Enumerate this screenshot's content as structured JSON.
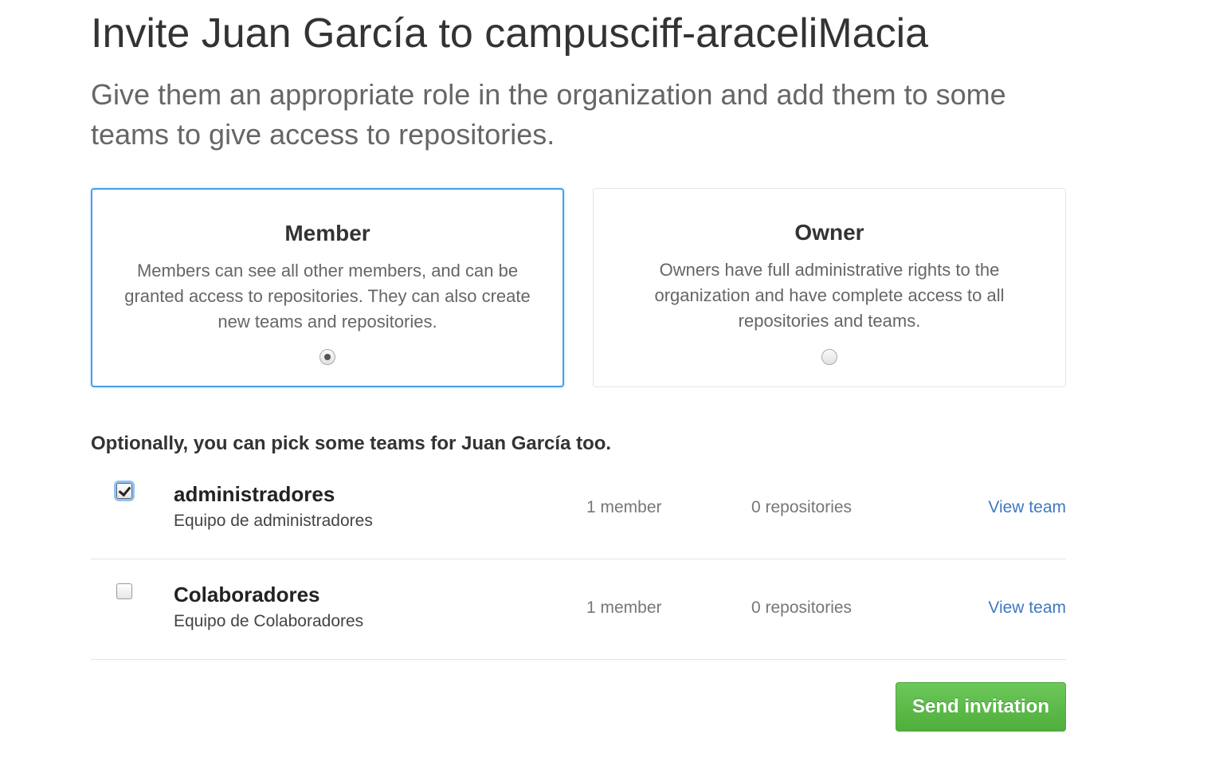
{
  "header": {
    "title": "Invite Juan García to campusciff-araceliMacia",
    "subtitle": "Give them an appropriate role in the organization and add them to some teams to give access to repositories."
  },
  "roles": [
    {
      "title": "Member",
      "description": "Members can see all other members, and can be granted access to repositories. They can also create new teams and repositories.",
      "selected": true
    },
    {
      "title": "Owner",
      "description": "Owners have full administrative rights to the organization and have complete access to all repositories and teams.",
      "selected": false
    }
  ],
  "teams": {
    "heading": "Optionally, you can pick some teams for Juan García too.",
    "items": [
      {
        "name": "administradores",
        "description": "Equipo de administradores",
        "members": "1 member",
        "repositories": "0 repositories",
        "link_label": "View team",
        "checked": true
      },
      {
        "name": "Colaboradores",
        "description": "Equipo de Colaboradores",
        "members": "1 member",
        "repositories": "0 repositories",
        "link_label": "View team",
        "checked": false
      }
    ]
  },
  "actions": {
    "send_label": "Send invitation"
  },
  "colors": {
    "accent": "#4a9ee8",
    "link": "#4078c0",
    "button": "#5cb848"
  }
}
